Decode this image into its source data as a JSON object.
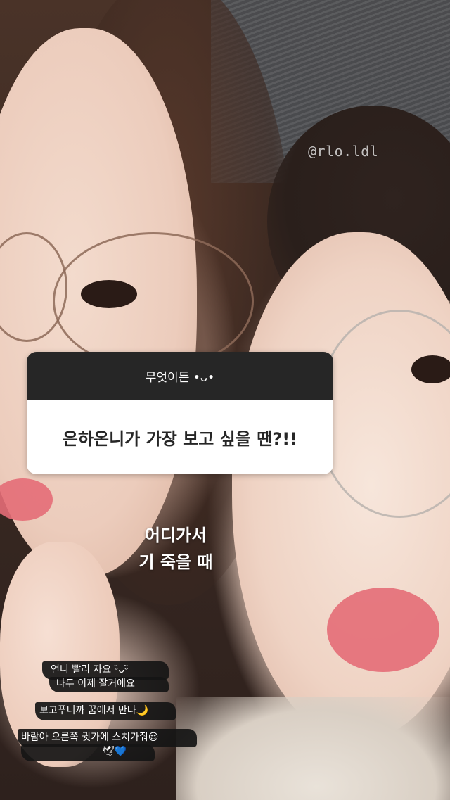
{
  "story": {
    "watermark": "@rlo.ldl",
    "question_box": {
      "header": "무엇이든 •ᴗ•",
      "question": "은하온니가 가장 보고 싶을 땐?!!"
    },
    "answer": {
      "line1": "어디가서",
      "line2": "기 죽을 때"
    },
    "notes": {
      "line1": "언니 빨리 자요 ᵕ̈ᴗᵕ̈",
      "line2": "나두 이제 잘거에요",
      "line3": "보고푸니까 꿈에서 만나🌙",
      "line4": "바람아 오른쪽 귓가에 스쳐가줘😌",
      "line5": "🕊💙"
    }
  }
}
